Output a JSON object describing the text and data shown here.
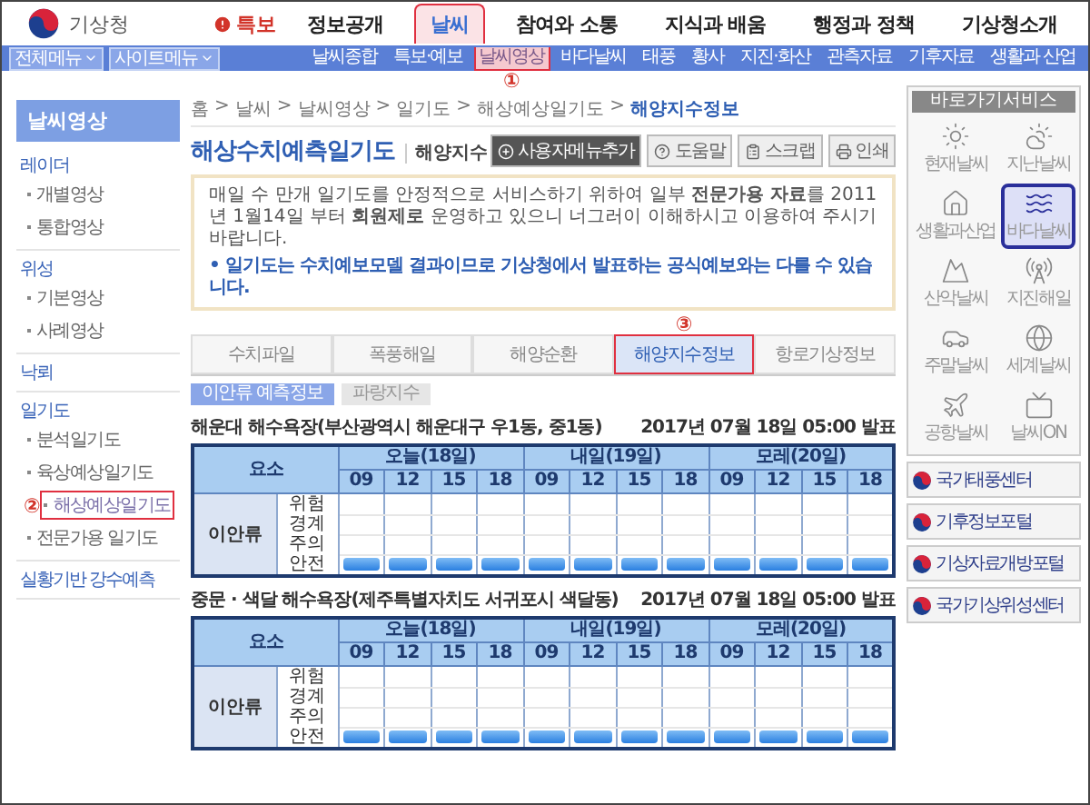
{
  "header": {
    "logo": "기상청",
    "alert": "특보",
    "nav": [
      {
        "label": "정보공개",
        "selected": false
      },
      {
        "label": "날씨",
        "selected": true
      },
      {
        "label": "참여와 소통",
        "selected": false
      },
      {
        "label": "지식과 배움",
        "selected": false
      },
      {
        "label": "행정과 정책",
        "selected": false
      },
      {
        "label": "기상청소개",
        "selected": false
      }
    ]
  },
  "subbar": {
    "menus": [
      "전체메뉴",
      "사이트메뉴"
    ],
    "items": [
      {
        "label": "날씨종합",
        "selected": false
      },
      {
        "label": "특보·예보",
        "selected": false
      },
      {
        "label": "날씨영상",
        "selected": true,
        "callout": "①"
      },
      {
        "label": "바다날씨",
        "selected": false
      },
      {
        "label": "태풍",
        "selected": false
      },
      {
        "label": "황사",
        "selected": false
      },
      {
        "label": "지진·화산",
        "selected": false
      },
      {
        "label": "관측자료",
        "selected": false
      },
      {
        "label": "기후자료",
        "selected": false
      },
      {
        "label": "생활과 산업",
        "selected": false
      }
    ]
  },
  "sidebar": {
    "title": "날씨영상",
    "groups": [
      {
        "label": "레이더",
        "children": [
          {
            "label": "개별영상",
            "selected": false
          },
          {
            "label": "통합영상",
            "selected": false
          }
        ]
      },
      {
        "label": "위성",
        "children": [
          {
            "label": "기본영상",
            "selected": false
          },
          {
            "label": "사례영상",
            "selected": false
          }
        ]
      },
      {
        "label": "낙뢰"
      },
      {
        "label": "일기도",
        "children": [
          {
            "label": "분석일기도",
            "selected": false
          },
          {
            "label": "육상예상일기도",
            "selected": false
          },
          {
            "label": "해상예상일기도",
            "selected": true,
            "callout": "②"
          },
          {
            "label": "전문가용 일기도",
            "selected": false
          }
        ]
      },
      {
        "label": "실황기반 강수예측"
      }
    ]
  },
  "main": {
    "breadcrumb": {
      "separator": ">",
      "items": [
        "홈",
        "날씨",
        "날씨영상",
        "일기도",
        "해상예상일기도",
        "해양지수정보"
      ]
    },
    "title": "해상수치예측일기도",
    "subtitle": "해양지수",
    "buttons": [
      {
        "label": "사용자메뉴추가",
        "kind": "add"
      },
      {
        "label": "도움말",
        "kind": "help"
      },
      {
        "label": "스크랩",
        "kind": "scrap"
      },
      {
        "label": "인쇄",
        "kind": "print"
      }
    ],
    "notice": {
      "text": "매일 수 만개 일기도를 안정적으로 서비스하기 위하여 일부 **전문가용 자료**를 2011년 1월14일 부터 **회원제로** 운영하고 있으니 너그러이 이해하시고 이용하여 주시기 바랍니다.",
      "note": "• 일기도는 수치예보모델 결과이므로 기상청에서 발표하는 공식예보와는 다를 수 있습니다."
    },
    "tabs": [
      {
        "label": "수치파일",
        "selected": false
      },
      {
        "label": "폭풍해일",
        "selected": false
      },
      {
        "label": "해양순환",
        "selected": false
      },
      {
        "label": "해양지수정보",
        "selected": true,
        "callout": "③"
      },
      {
        "label": "항로기상정보",
        "selected": false
      }
    ],
    "subtabs": [
      {
        "label": "이안류 예측정보",
        "selected": true
      },
      {
        "label": "파랑지수",
        "selected": false
      }
    ],
    "tables": [
      {
        "title": "해운대 해수욕장(부산광역시 해운대구 우1동, 중1동)",
        "issued": "2017년 07월 18일 05:00 발표",
        "element": "요소",
        "category": "이안류",
        "days": [
          {
            "label": "오늘(18일)",
            "times": [
              "09",
              "12",
              "15",
              "18"
            ]
          },
          {
            "label": "내일(19일)",
            "times": [
              "09",
              "12",
              "15",
              "18"
            ]
          },
          {
            "label": "모레(20일)",
            "times": [
              "09",
              "12",
              "15",
              "18"
            ]
          }
        ],
        "rows": [
          {
            "label": "위험",
            "marks": [
              false,
              false,
              false,
              false,
              false,
              false,
              false,
              false,
              false,
              false,
              false,
              false
            ]
          },
          {
            "label": "경계",
            "marks": [
              false,
              false,
              false,
              false,
              false,
              false,
              false,
              false,
              false,
              false,
              false,
              false
            ]
          },
          {
            "label": "주의",
            "marks": [
              false,
              false,
              false,
              false,
              false,
              false,
              false,
              false,
              false,
              false,
              false,
              false
            ]
          },
          {
            "label": "안전",
            "marks": [
              true,
              true,
              true,
              true,
              true,
              true,
              true,
              true,
              true,
              true,
              true,
              true
            ]
          }
        ]
      },
      {
        "title": "중문 · 색달 해수욕장(제주특별자치도 서귀포시 색달동)",
        "issued": "2017년 07월 18일 05:00 발표",
        "element": "요소",
        "category": "이안류",
        "days": [
          {
            "label": "오늘(18일)",
            "times": [
              "09",
              "12",
              "15",
              "18"
            ]
          },
          {
            "label": "내일(19일)",
            "times": [
              "09",
              "12",
              "15",
              "18"
            ]
          },
          {
            "label": "모레(20일)",
            "times": [
              "09",
              "12",
              "15",
              "18"
            ]
          }
        ],
        "rows": [
          {
            "label": "위험",
            "marks": [
              false,
              false,
              false,
              false,
              false,
              false,
              false,
              false,
              false,
              false,
              false,
              false
            ]
          },
          {
            "label": "경계",
            "marks": [
              false,
              false,
              false,
              false,
              false,
              false,
              false,
              false,
              false,
              false,
              false,
              false
            ]
          },
          {
            "label": "주의",
            "marks": [
              false,
              false,
              false,
              false,
              false,
              false,
              false,
              false,
              false,
              false,
              false,
              false
            ]
          },
          {
            "label": "안전",
            "marks": [
              true,
              true,
              true,
              true,
              true,
              true,
              true,
              true,
              true,
              true,
              true,
              true
            ]
          }
        ]
      }
    ]
  },
  "quick": {
    "title": "바로가기서비스",
    "shortcuts": [
      {
        "label": "현재날씨",
        "kind": "sun",
        "selected": false
      },
      {
        "label": "지난날씨",
        "kind": "cloudsun",
        "selected": false
      },
      {
        "label": "생활과산업",
        "kind": "house",
        "selected": false
      },
      {
        "label": "바다날씨",
        "kind": "waves",
        "selected": true
      },
      {
        "label": "산악날씨",
        "kind": "mountain",
        "selected": false
      },
      {
        "label": "지진해일",
        "kind": "tower",
        "selected": false
      },
      {
        "label": "주말날씨",
        "kind": "car",
        "selected": false
      },
      {
        "label": "세계날씨",
        "kind": "globe",
        "selected": false
      },
      {
        "label": "공항날씨",
        "kind": "plane",
        "selected": false
      },
      {
        "label": "날씨ON",
        "kind": "tv",
        "selected": false
      }
    ],
    "links": [
      "국가태풍센터",
      "기후정보포털",
      "기상자료개방포털",
      "국가기상위성센터"
    ]
  }
}
